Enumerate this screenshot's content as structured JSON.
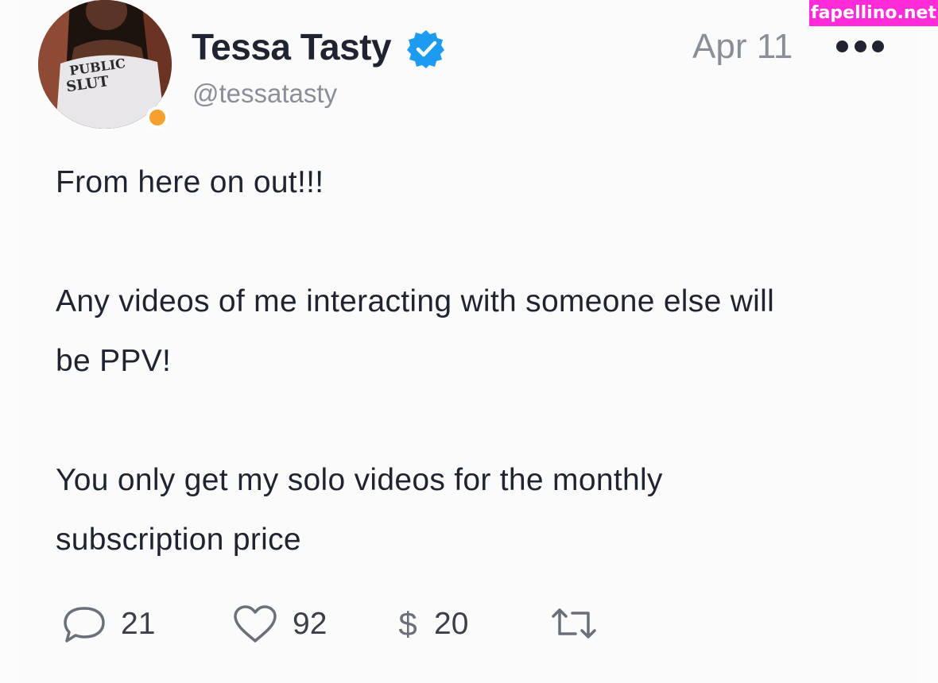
{
  "watermark": {
    "text": "fapellino.net"
  },
  "post": {
    "author": {
      "display_name": "Tessa Tasty",
      "handle": "@tessatasty",
      "verified_icon": "verified-badge-icon",
      "avatar_shirt_text_line1": "PUBLIC",
      "avatar_shirt_text_line2": "SLUT",
      "status_color": "#f6a030"
    },
    "date": "Apr 11",
    "more_icon": "more-dots-icon",
    "body": {
      "line1": "From here on out!!!",
      "line2": "Any videos of me interacting with someone else will",
      "line3": "be PPV!",
      "line4": "You only get my solo videos for the monthly",
      "line5": "subscription price"
    },
    "actions": {
      "comment": {
        "icon": "comment-icon",
        "count": "21"
      },
      "like": {
        "icon": "heart-icon",
        "count": "92"
      },
      "tip": {
        "icon": "dollar-icon",
        "symbol": "$",
        "count": "20"
      },
      "repost": {
        "icon": "repost-icon"
      }
    }
  },
  "colors": {
    "accent_verified": "#1d9bf0",
    "watermark_bg": "#ff2bd9",
    "text_primary": "#1f2430",
    "text_secondary": "#8a8e99"
  }
}
